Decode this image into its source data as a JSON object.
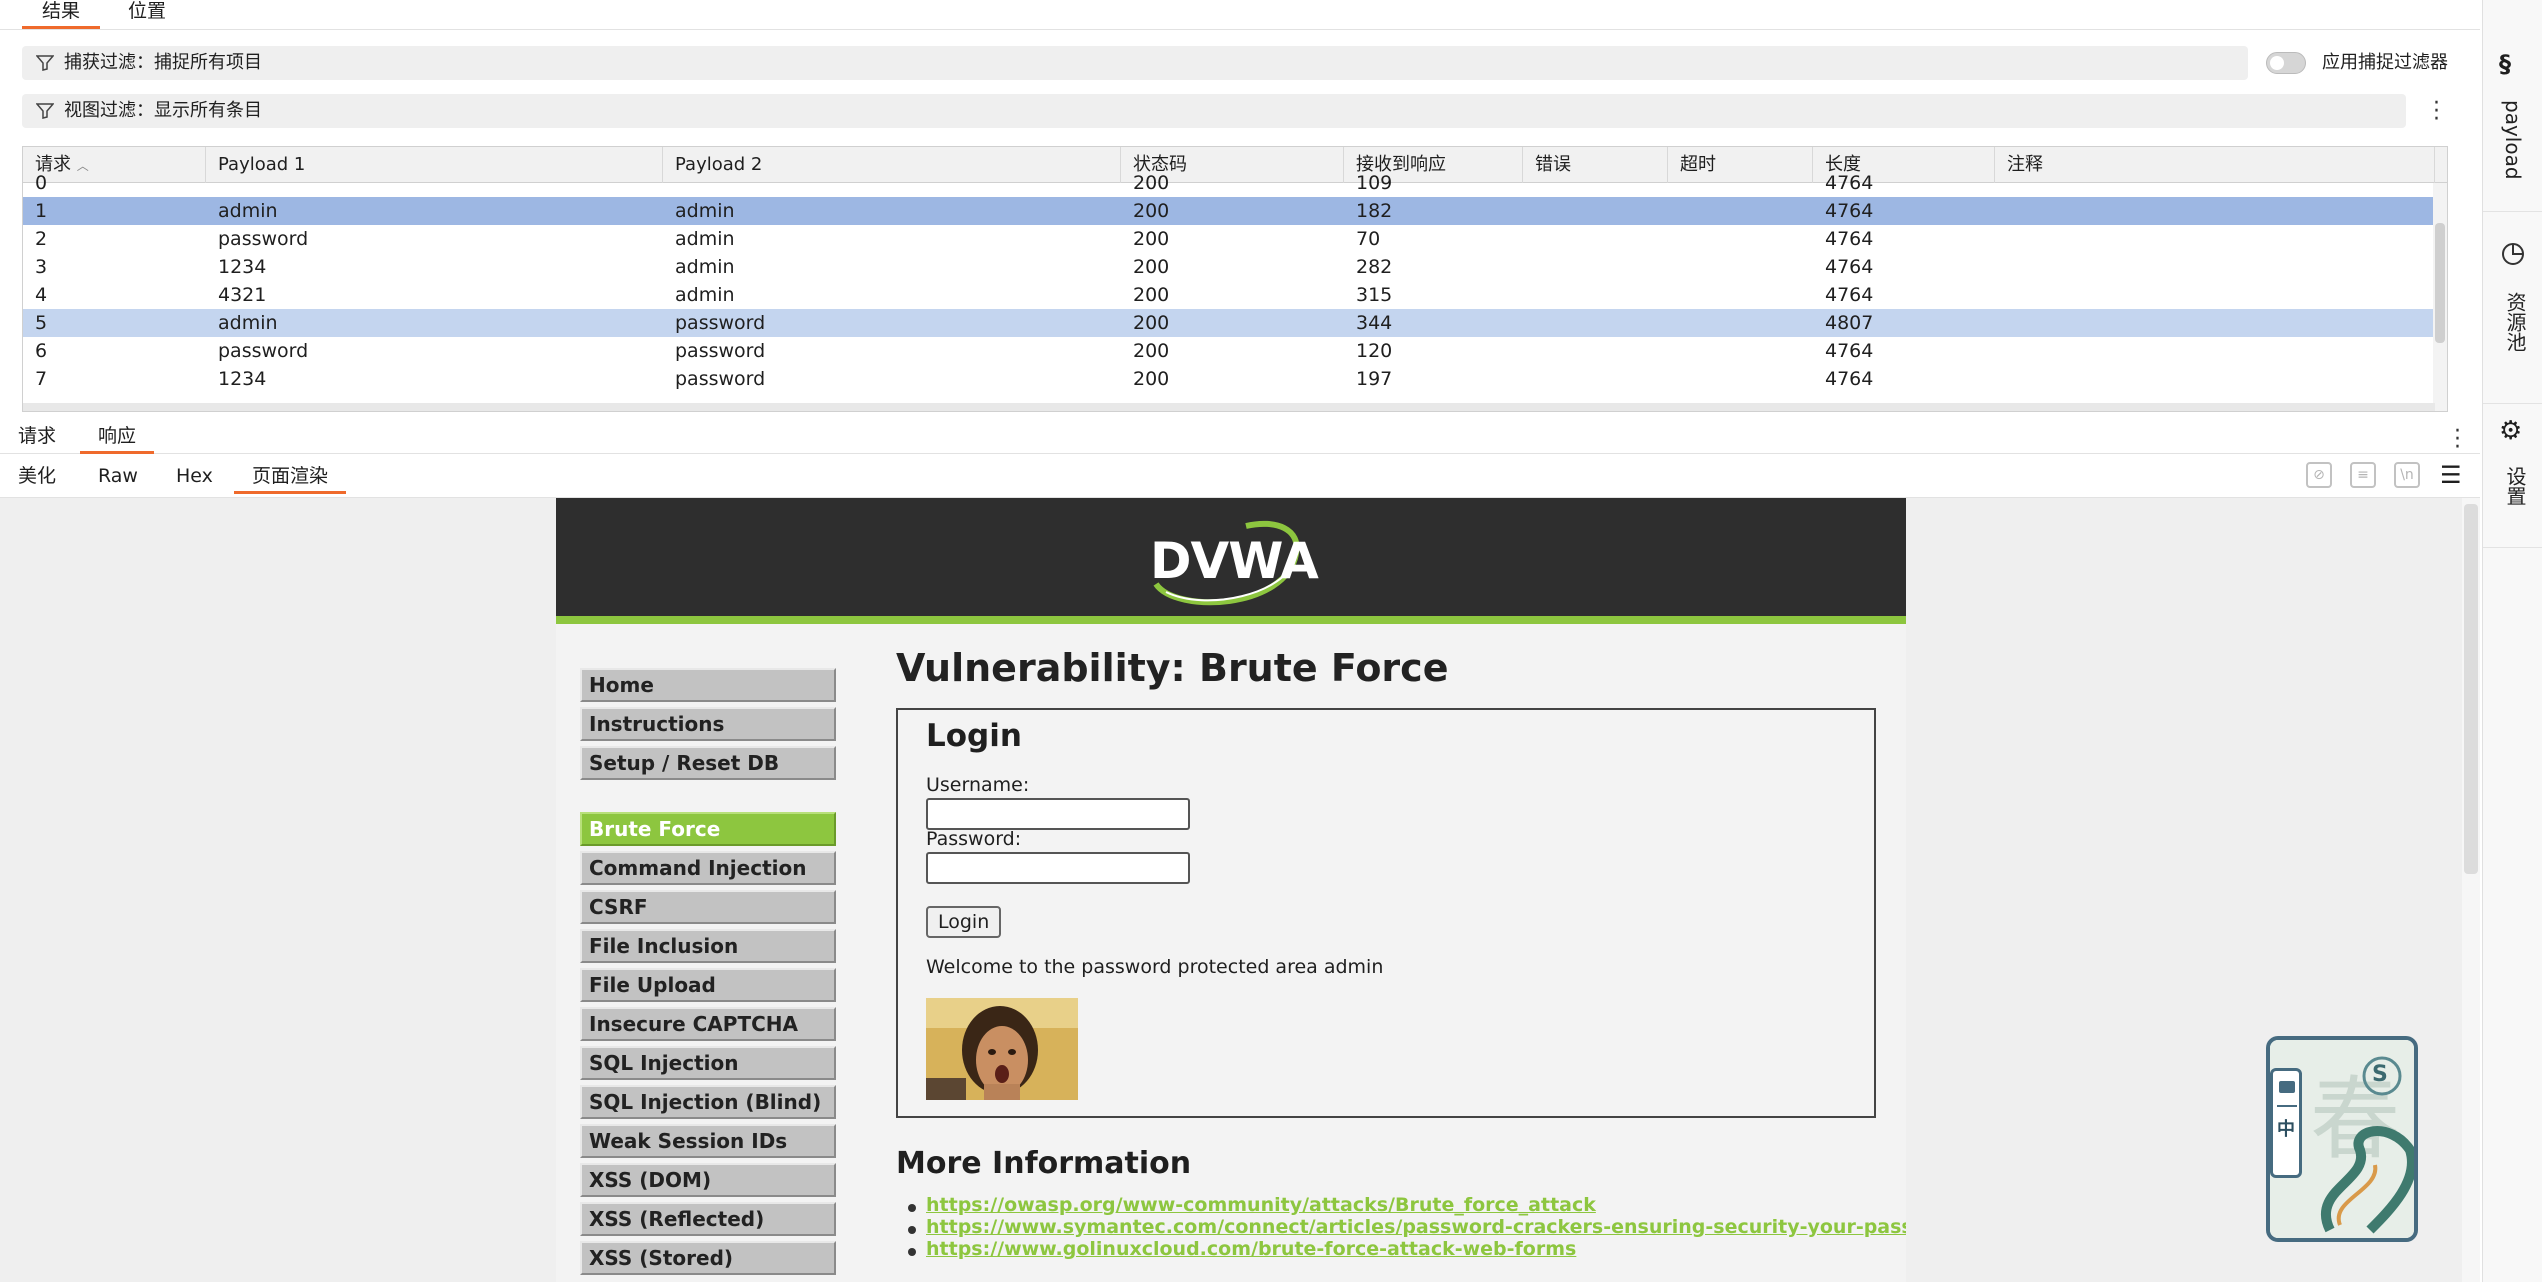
{
  "top_tabs": [
    "结果",
    "位置"
  ],
  "capture_filter": "捕获过滤：捕捉所有项目",
  "view_filter": "视图过滤：显示所有条目",
  "apply_capture_filter": "应用捕捉过滤器",
  "table": {
    "headers": [
      "请求",
      "Payload 1",
      "Payload 2",
      "状态码",
      "接收到响应",
      "错误",
      "超时",
      "长度",
      "注释"
    ],
    "rows": [
      [
        "0",
        "",
        "",
        "200",
        "109",
        "",
        "",
        "4764",
        ""
      ],
      [
        "1",
        "admin",
        "admin",
        "200",
        "182",
        "",
        "",
        "4764",
        ""
      ],
      [
        "2",
        "password",
        "admin",
        "200",
        "70",
        "",
        "",
        "4764",
        ""
      ],
      [
        "3",
        "1234",
        "admin",
        "200",
        "282",
        "",
        "",
        "4764",
        ""
      ],
      [
        "4",
        "4321",
        "admin",
        "200",
        "315",
        "",
        "",
        "4764",
        ""
      ],
      [
        "5",
        "admin",
        "password",
        "200",
        "344",
        "",
        "",
        "4807",
        ""
      ],
      [
        "6",
        "password",
        "password",
        "200",
        "120",
        "",
        "",
        "4764",
        ""
      ],
      [
        "7",
        "1234",
        "password",
        "200",
        "197",
        "",
        "",
        "4764",
        ""
      ]
    ]
  },
  "rr_tabs": [
    "请求",
    "响应"
  ],
  "view_tabs": [
    "美化",
    "Raw",
    "Hex",
    "页面渲染"
  ],
  "toolbar_icons": [
    "eye-off-icon",
    "wrap-icon",
    "newline-icon",
    "menu-icon"
  ],
  "dvwa": {
    "logo": "DVWA",
    "menu_top": [
      "Home",
      "Instructions",
      "Setup / Reset DB"
    ],
    "menu_vulns": [
      "Brute Force",
      "Command Injection",
      "CSRF",
      "File Inclusion",
      "File Upload",
      "Insecure CAPTCHA",
      "SQL Injection",
      "SQL Injection (Blind)",
      "Weak Session IDs",
      "XSS (DOM)",
      "XSS (Reflected)",
      "XSS (Stored)"
    ],
    "title": "Vulnerability: Brute Force",
    "login_heading": "Login",
    "username_label": "Username:",
    "password_label": "Password:",
    "login_button": "Login",
    "welcome": "Welcome to the password protected area admin",
    "more_info_heading": "More Information",
    "links": [
      "https://owasp.org/www-community/attacks/Brute_force_attack",
      "https://www.symantec.com/connect/articles/password-crackers-ensuring-security-your-password",
      "https://www.golinuxcloud.com/brute-force-attack-web-forms"
    ]
  },
  "right_panel": {
    "payload": "payload",
    "resource_pool": "资源池",
    "settings": "设置"
  },
  "widget": {
    "mode_label": "中",
    "logo_letter": "S"
  },
  "colors": {
    "accent": "#ef6a2c",
    "selected_row": "#9db7e3",
    "selected_row_alt": "#c4d5ef",
    "dvwa_green": "#8dc63f",
    "dvwa_header": "#2e2e2e"
  }
}
